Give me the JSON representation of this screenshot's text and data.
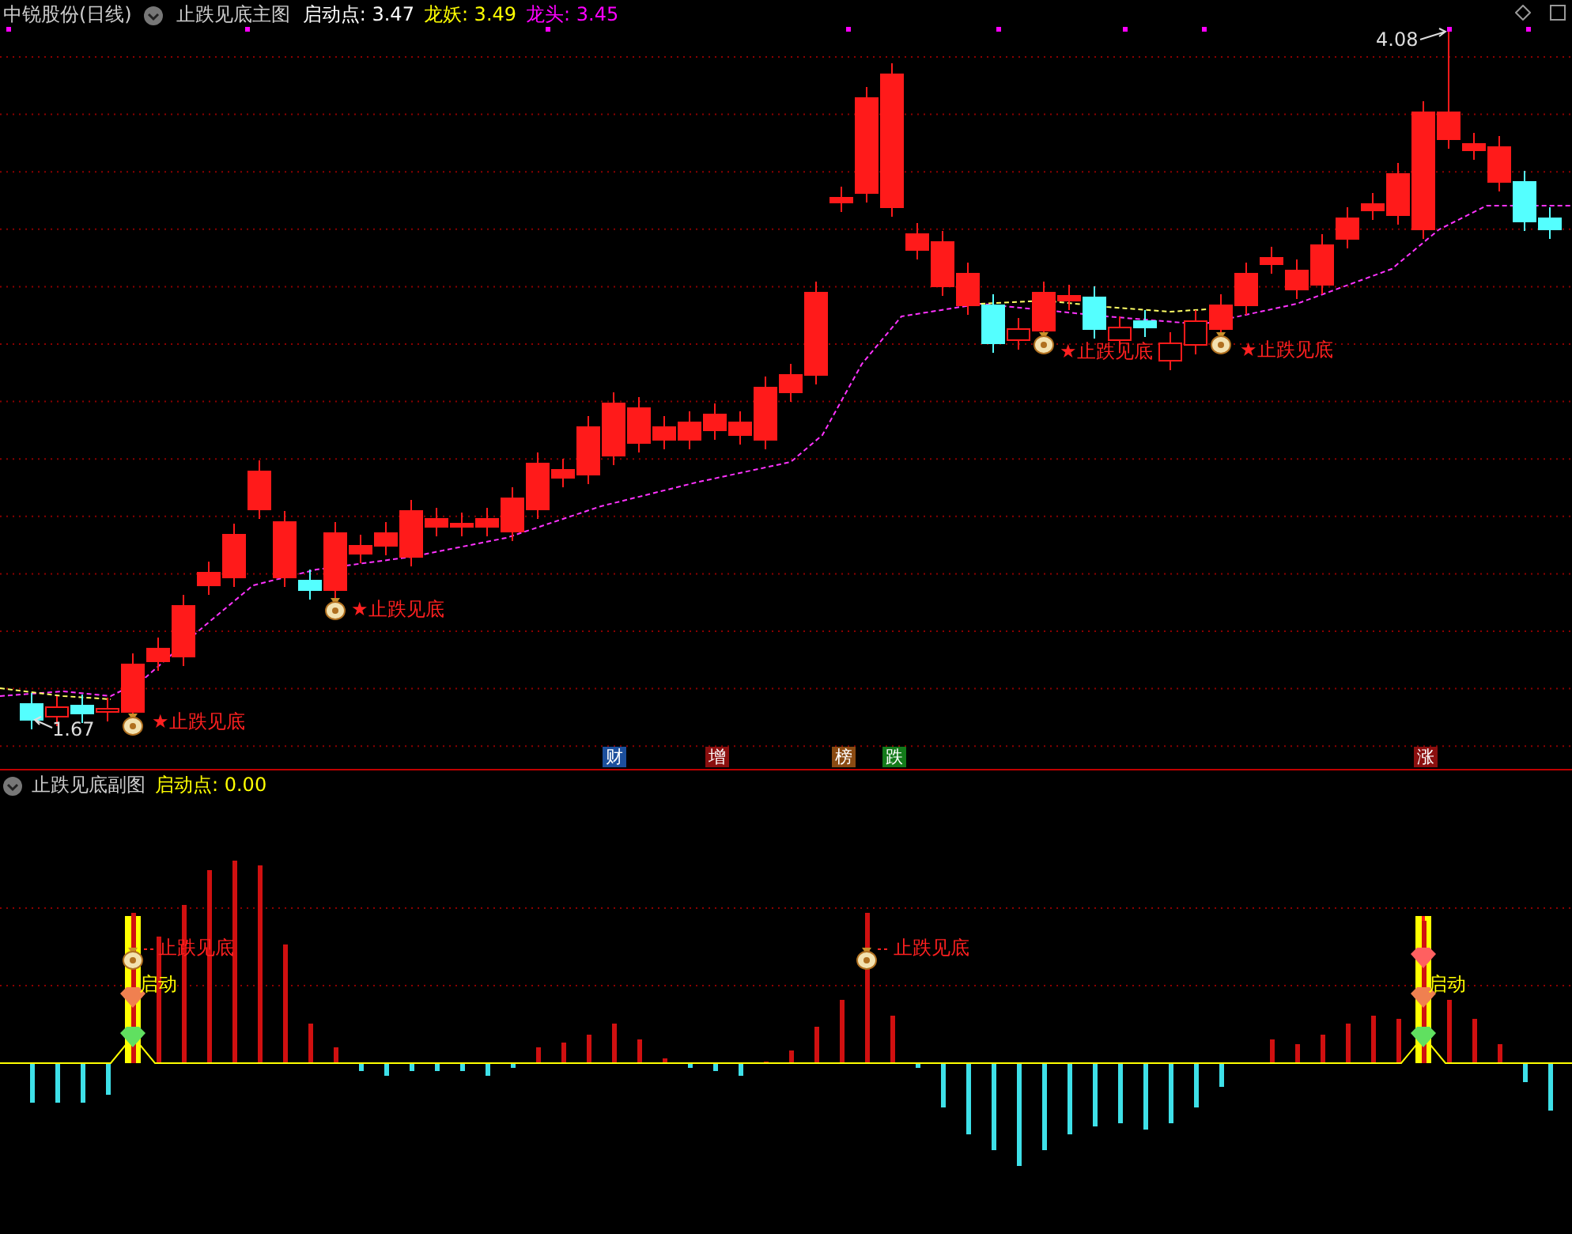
{
  "header": {
    "stock": "中锐股份(日线)",
    "indicator": "止跌见底主图",
    "values": [
      {
        "text": "启动点: 3.47",
        "color": "#ffffff"
      },
      {
        "text": "龙妖: 3.49",
        "color": "#ffff00"
      },
      {
        "text": "龙头: 3.45",
        "color": "#ff00ff"
      }
    ]
  },
  "main_chart": {
    "high_label": "4.08",
    "low_label": "1.67",
    "signals": [
      "★止跌见底",
      "★止跌见底",
      "★止跌见底",
      "★止跌见底"
    ],
    "events": [
      {
        "text": "财",
        "color": "#1c4f9c"
      },
      {
        "text": "增",
        "color": "#8b0f0f"
      },
      {
        "text": "榜",
        "color": "#8a4a12"
      },
      {
        "text": "跌",
        "color": "#137a1a"
      },
      {
        "text": "涨",
        "color": "#8b0f0f"
      }
    ]
  },
  "sub_chart": {
    "title": "止跌见底副图",
    "readout": "启动点: 0.00",
    "signals": [
      {
        "kind": "bottom",
        "text": "止跌见底"
      },
      {
        "kind": "bottom",
        "text": "止跌见底"
      },
      {
        "kind": "start",
        "text": "启动"
      },
      {
        "kind": "start",
        "text": "启动"
      }
    ]
  }
}
